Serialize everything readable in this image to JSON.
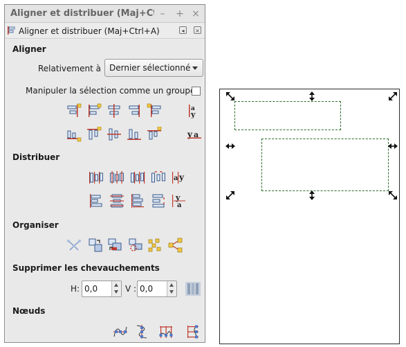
{
  "window": {
    "title": "Aligner et distribuer (Maj+Ct...",
    "minimize_glyph": "–",
    "maximize_glyph": "+",
    "close_glyph": "×"
  },
  "dock": {
    "label": "Aligner et distribuer (Maj+Ctrl+A)",
    "icon": "align-distribute-icon",
    "float_glyph": "◂",
    "close_glyph": "×"
  },
  "align": {
    "heading": "Aligner",
    "relative_label": "Relativement à :",
    "relative_value": "Dernier sélectionné",
    "group_label": "Manipuler la sélection comme un groupe :",
    "group_checked": false,
    "row1_icons": [
      "align-right-edge-to-left-icon",
      "align-left-edges-icon",
      "align-center-vertical-axis-icon",
      "align-right-edges-icon",
      "align-left-edge-to-right-icon",
      "align-baseline-text-icon"
    ],
    "row2_icons": [
      "align-bottom-to-top-icon",
      "align-top-edges-icon",
      "align-center-horizontal-axis-icon",
      "align-bottom-edges-icon",
      "align-top-to-bottom-icon",
      "align-baselines-icon"
    ]
  },
  "distribute": {
    "heading": "Distribuer",
    "row1_icons": [
      "distribute-left-edges-icon",
      "distribute-centers-horizontal-icon",
      "distribute-right-edges-icon",
      "distribute-gaps-horizontal-icon",
      "distribute-baselines-horizontal-icon"
    ],
    "row2_icons": [
      "distribute-top-edges-icon",
      "distribute-centers-vertical-icon",
      "distribute-bottom-edges-icon",
      "distribute-gaps-vertical-icon",
      "distribute-baselines-vertical-icon"
    ]
  },
  "arrange": {
    "heading": "Organiser",
    "icons": [
      "graph-layout-icon",
      "exchange-positions-icon",
      "exchange-z-order-icon",
      "exchange-clockwise-icon",
      "randomize-positions-icon",
      "unclump-icon"
    ]
  },
  "overlap": {
    "heading": "Supprimer les chevauchements",
    "h_label": "H:",
    "h_value": "0,0",
    "v_label": "V :",
    "v_value": "0,0",
    "apply_icon": "remove-overlaps-icon"
  },
  "nodes": {
    "heading": "Nœuds",
    "icons": [
      "align-nodes-horizontal-icon",
      "align-nodes-vertical-icon",
      "distribute-nodes-horizontal-icon",
      "distribute-nodes-vertical-icon"
    ]
  },
  "colors": {
    "accent_red": "#c0392b",
    "selection_green": "#2c6b2c",
    "icon_blue": "#5a7db8",
    "icon_yellow": "#f2c744"
  }
}
